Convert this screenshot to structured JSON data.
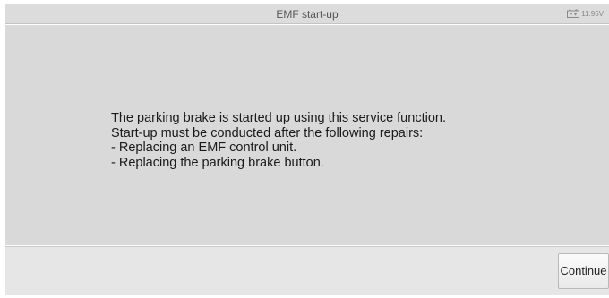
{
  "header": {
    "title": "EMF start-up",
    "battery_voltage": "11.95V",
    "battery_icon": "battery-icon"
  },
  "main": {
    "message_lines": [
      "The parking brake is started up using this service function.",
      "Start-up must be conducted after the following repairs:",
      "- Replacing an EMF control unit.",
      "- Replacing the parking brake button."
    ]
  },
  "footer": {
    "continue_label": "Continue"
  },
  "colors": {
    "header_bg": "#dcdcdc",
    "content_bg": "#d9d9d9",
    "footer_bg": "#e6e6e6"
  }
}
